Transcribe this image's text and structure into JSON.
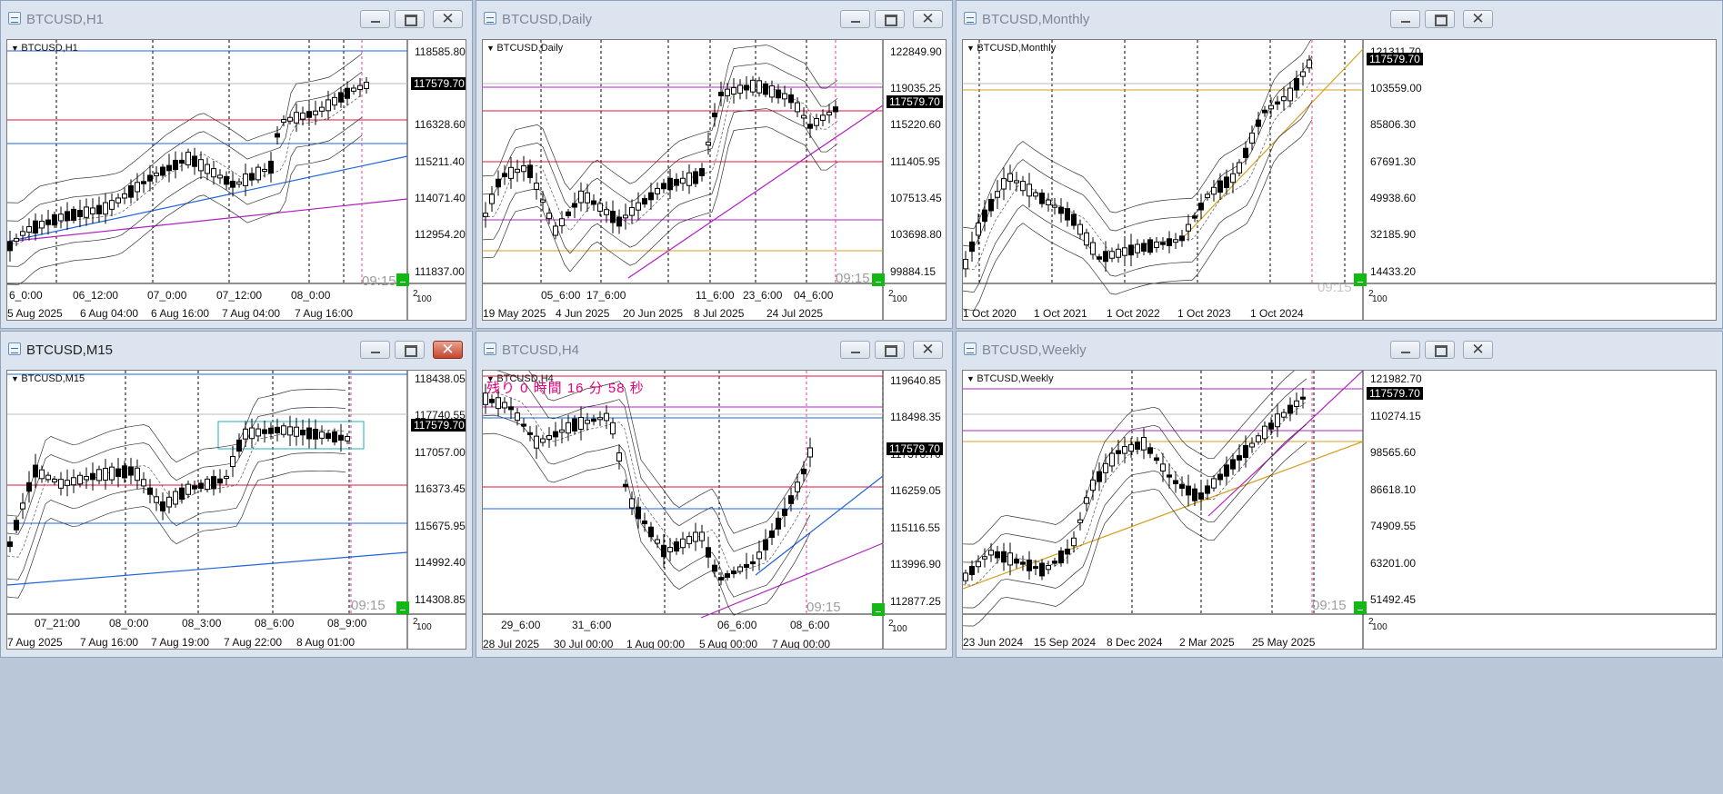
{
  "colors": {
    "accent_red": "#dc143c",
    "accent_blue": "#1e64dc",
    "accent_magenta": "#b020c0",
    "accent_gold": "#d4a020",
    "accent_teal": "#20b0b0",
    "price_box": "#000000",
    "time_label": "#9e9e9e",
    "green_box": "#14b814"
  },
  "windows": [
    {
      "title": "BTCUSD,H1",
      "label": "BTCUSD,H1",
      "close_style": "normal",
      "y_ticks": [
        "118585.80",
        "116328.60",
        "115211.40",
        "114071.40",
        "112954.20",
        "111837.00"
      ],
      "price": "117579.70",
      "x_time_ticks": [
        "6_0:00",
        "06_12:00",
        "07_0:00",
        "07_12:00",
        "08_0:00"
      ],
      "x_date_ticks": [
        "5 Aug 2025",
        "6 Aug 04:00",
        "6 Aug 16:00",
        "7 Aug 04:00",
        "7 Aug 16:00"
      ],
      "time_label": "09:15",
      "corner": "2",
      "corner2": "100"
    },
    {
      "title": "BTCUSD,Daily",
      "label": "BTCUSD,Daily",
      "close_style": "normal",
      "y_ticks": [
        "122849.90",
        "119035.25",
        "115220.60",
        "111405.95",
        "107513.45",
        "103698.80",
        "99884.15"
      ],
      "price": "117579.70",
      "x_time_ticks": [
        "05_6:00",
        "17_6:00",
        "11_6:00",
        "23_6:00",
        "04_6:00"
      ],
      "x_date_ticks": [
        "19 May 2025",
        "4 Jun 2025",
        "20 Jun 2025",
        "8 Jul 2025",
        "24 Jul 2025"
      ],
      "time_label": "09:15",
      "corner": "2",
      "corner2": "100"
    },
    {
      "title": "BTCUSD,Monthly",
      "label": "BTCUSD,Monthly",
      "close_style": "normal",
      "y_ticks": [
        "121311.70",
        "103559.00",
        "85806.30",
        "67691.30",
        "49938.60",
        "32185.90",
        "14433.20"
      ],
      "price": "117579.70",
      "x_time_ticks": [],
      "x_date_ticks": [
        "1 Oct 2020",
        "1 Oct 2021",
        "1 Oct 2022",
        "1 Oct 2023",
        "1 Oct 2024"
      ],
      "time_label": "09:15",
      "corner": "2",
      "corner2": "100"
    },
    {
      "title": "BTCUSD,M15",
      "label": "BTCUSD,M15",
      "close_style": "red",
      "y_ticks": [
        "118438.05",
        "117740.55",
        "117057.00",
        "116373.45",
        "115675.95",
        "114992.40",
        "114308.85"
      ],
      "price": "117579.70",
      "x_time_ticks": [
        "07_21:00",
        "08_0:00",
        "08_3:00",
        "08_6:00",
        "08_9:00"
      ],
      "x_date_ticks": [
        "7 Aug 2025",
        "7 Aug 16:00",
        "7 Aug 19:00",
        "7 Aug 22:00",
        "8 Aug 01:00"
      ],
      "time_label": "09:15",
      "corner": "2",
      "corner2": "100"
    },
    {
      "title": "BTCUSD,H4",
      "label": "BTCUSD,H4",
      "close_style": "normal",
      "timer_text": "残り 0 時間 16 分 58 秒",
      "y_ticks": [
        "119640.85",
        "118498.35",
        "117378.70",
        "116259.05",
        "115116.55",
        "113996.90",
        "112877.25"
      ],
      "price": "117579.70",
      "x_time_ticks": [
        "29_6:00",
        "31_6:00",
        "06_6:00",
        "08_6:00"
      ],
      "x_date_ticks": [
        "28 Jul 2025",
        "30 Jul 00:00",
        "1 Aug 00:00",
        "5 Aug 00:00",
        "7 Aug 00:00"
      ],
      "time_label": "09:15",
      "corner": "2",
      "corner2": "100"
    },
    {
      "title": "BTCUSD,Weekly",
      "label": "BTCUSD,Weekly",
      "close_style": "normal",
      "y_ticks": [
        "121982.70",
        "110274.15",
        "98565.60",
        "86618.10",
        "74909.55",
        "63201.00",
        "51492.45"
      ],
      "price": "117579.70",
      "x_time_ticks": [],
      "x_date_ticks": [
        "23 Jun 2024",
        "15 Sep 2024",
        "8 Dec 2024",
        "2 Mar 2025",
        "25 May 2025"
      ],
      "time_label": "09:15",
      "corner": "2",
      "corner2": "100"
    }
  ]
}
